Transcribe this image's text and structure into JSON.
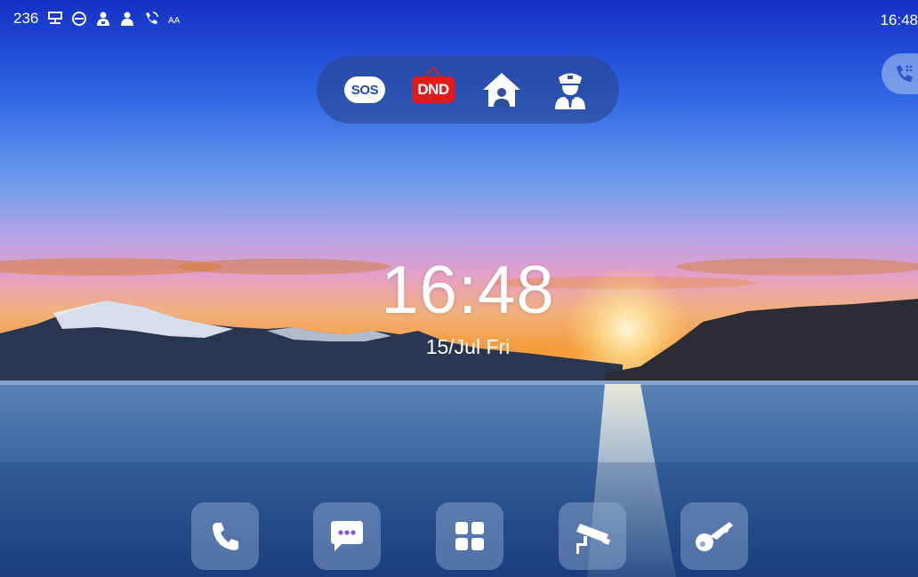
{
  "statusbar": {
    "extension": "236",
    "time": "16:48",
    "icons": [
      "network-icon",
      "dnd-status-icon",
      "group-contact-icon",
      "contact-icon",
      "call-forward-icon",
      "text-size-icon"
    ],
    "text_size_label": "AA"
  },
  "quick_actions": [
    {
      "label": "SOS",
      "icon": "sos-icon"
    },
    {
      "label": "DND",
      "icon": "dnd-icon"
    },
    {
      "label": "",
      "icon": "home-user-icon"
    },
    {
      "label": "",
      "icon": "guard-icon"
    }
  ],
  "home": {
    "clock": "16:48",
    "date": "15/Jul Fri"
  },
  "dock": [
    {
      "icon": "phone-icon"
    },
    {
      "icon": "message-icon"
    },
    {
      "icon": "apps-grid-icon"
    },
    {
      "icon": "security-camera-icon"
    },
    {
      "icon": "key-icon"
    }
  ],
  "colors": {
    "sky_top": "#1636c8",
    "sky_mid": "#3d7be8",
    "sunset": "#f09a3c",
    "dnd_red": "#e21b1b",
    "message_purple": "#8a4fe0"
  }
}
